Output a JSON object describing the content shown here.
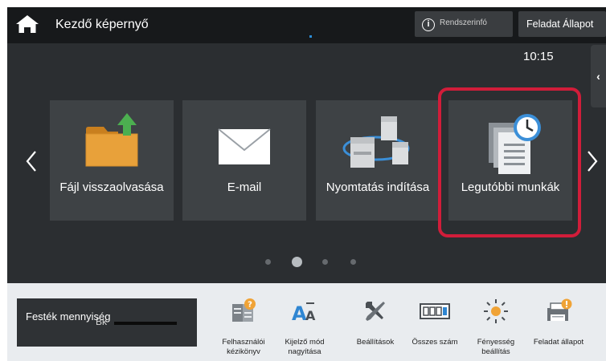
{
  "topbar": {
    "title": "Kezdő képernyő",
    "system_info_label": "Rendszerinfó",
    "job_status_label": "Feladat Állapot"
  },
  "clock": "10:15",
  "tiles": [
    {
      "label": "Fájl visszaolvasása",
      "icon": "folder-upload-icon"
    },
    {
      "label": "E-mail",
      "icon": "envelope-icon"
    },
    {
      "label": "Nyomtatás indítása",
      "icon": "network-printers-icon"
    },
    {
      "label": "Legutóbbi munkák",
      "icon": "recent-jobs-clock-icon"
    }
  ],
  "pagination": {
    "page_count": 4,
    "active_page": 2
  },
  "bottom": {
    "toner_label": "Festék mennyiség",
    "toner_color": "Bk",
    "shortcuts": [
      {
        "label": "Felhasználói kézikönyv",
        "icon": "manual-book-icon"
      },
      {
        "label": "Kijelző mód nagyítása",
        "icon": "font-enlarge-icon"
      },
      {
        "label": "Beállítások",
        "icon": "tools-icon"
      },
      {
        "label": "Összes szám",
        "icon": "counter-icon"
      },
      {
        "label": "Fényesség beállítás",
        "icon": "brightness-icon"
      },
      {
        "label": "Feladat állapot",
        "icon": "job-status-printer-icon"
      }
    ]
  },
  "colors": {
    "highlight": "#d11d3a",
    "accent_orange": "#f0a336",
    "accent_blue": "#3b8fd8",
    "folder": "#e8a13a",
    "arrow_green": "#4caf50"
  }
}
